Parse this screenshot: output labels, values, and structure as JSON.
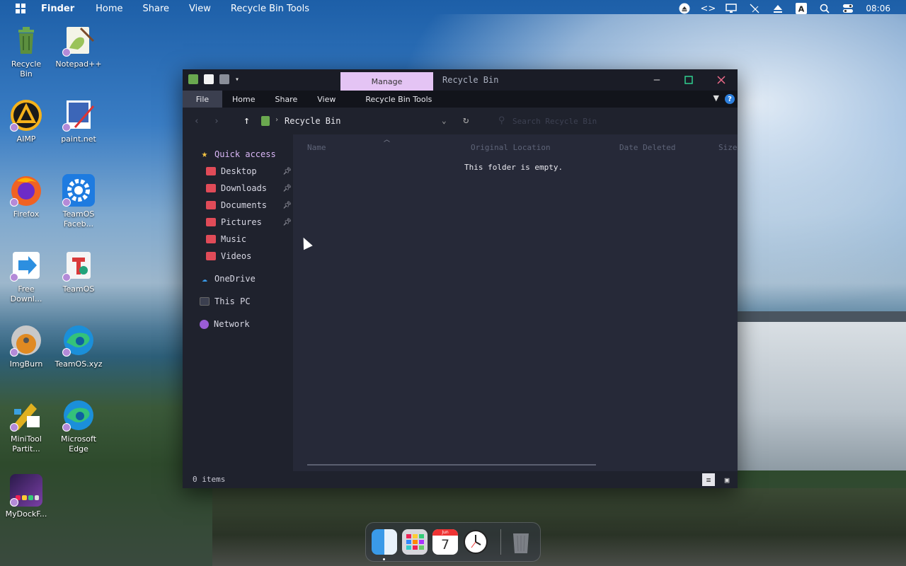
{
  "menubar": {
    "items": [
      "Finder",
      "Home",
      "Share",
      "View",
      "Recycle Bin Tools"
    ],
    "clock": "08:06",
    "tray_icons": [
      "eject-icon",
      "code-icon",
      "monitor-icon",
      "pen-off-icon",
      "upload-icon",
      "font-icon",
      "search-icon",
      "control-center-icon"
    ]
  },
  "desktop": {
    "icons": [
      {
        "name": "recycle-bin",
        "label": "Recycle\nBin",
        "label_a": "Recycle",
        "label_b": "Bin",
        "color": "#5c8f3f"
      },
      {
        "name": "notepadpp",
        "label_a": "Notepad++",
        "label_b": "",
        "color": "#9ac35a"
      },
      {
        "name": "aimp",
        "label_a": "AIMP",
        "label_b": "",
        "color": "#f5b21b"
      },
      {
        "name": "paintnet",
        "label_a": "paint.net",
        "label_b": "",
        "color": "#3c66b8"
      },
      {
        "name": "firefox",
        "label_a": "Firefox",
        "label_b": "",
        "color": "#f06223"
      },
      {
        "name": "teamos-facebook",
        "label_a": "TeamOS",
        "label_b": "Faceb...",
        "color": "#1e7be0"
      },
      {
        "name": "free-download",
        "label_a": "Free",
        "label_b": "Downl...",
        "color": "#2c8fe0"
      },
      {
        "name": "teamos",
        "label_a": "TeamOS",
        "label_b": "",
        "color": "#d93a3a"
      },
      {
        "name": "imgburn",
        "label_a": "ImgBurn",
        "label_b": "",
        "color": "#e08a22"
      },
      {
        "name": "teamos-xyz",
        "label_a": "TeamOS.xyz",
        "label_b": "",
        "color": "#21a27a"
      },
      {
        "name": "minitool",
        "label_a": "MiniTool",
        "label_b": "Partit...",
        "color": "#e0b020"
      },
      {
        "name": "microsoft-edge",
        "label_a": "Microsoft",
        "label_b": "Edge",
        "color": "#1b8fd9"
      },
      {
        "name": "mydockfinder",
        "label_a": "MyDockF...",
        "label_b": "",
        "color": "#7a3fa6"
      }
    ]
  },
  "window": {
    "manage_tab": "Manage",
    "title": "Recycle Bin",
    "ribbon_tabs": [
      "File",
      "Home",
      "Share",
      "View",
      "Recycle Bin Tools"
    ],
    "address": "Recycle Bin",
    "search_placeholder": "Search Recycle Bin",
    "columns": [
      "Name",
      "Original Location",
      "Date Deleted",
      "Size"
    ],
    "empty_message": "This folder is empty.",
    "status": "0 items",
    "nav": {
      "quick_access": "Quick access",
      "pinned": [
        "Desktop",
        "Downloads",
        "Documents",
        "Pictures"
      ],
      "unpinned": [
        "Music",
        "Videos"
      ],
      "onedrive": "OneDrive",
      "this_pc": "This PC",
      "network": "Network"
    }
  },
  "dock": {
    "items": [
      "finder",
      "launchpad",
      "calendar",
      "clock",
      "trash"
    ],
    "calendar_month": "Jun",
    "calendar_day": "7"
  },
  "colors": {
    "manage_tab": "#e4c4f4",
    "quick_access": "#d9b6f6",
    "folder_red": "#e04b58",
    "help_blue": "#2d7fdc"
  }
}
